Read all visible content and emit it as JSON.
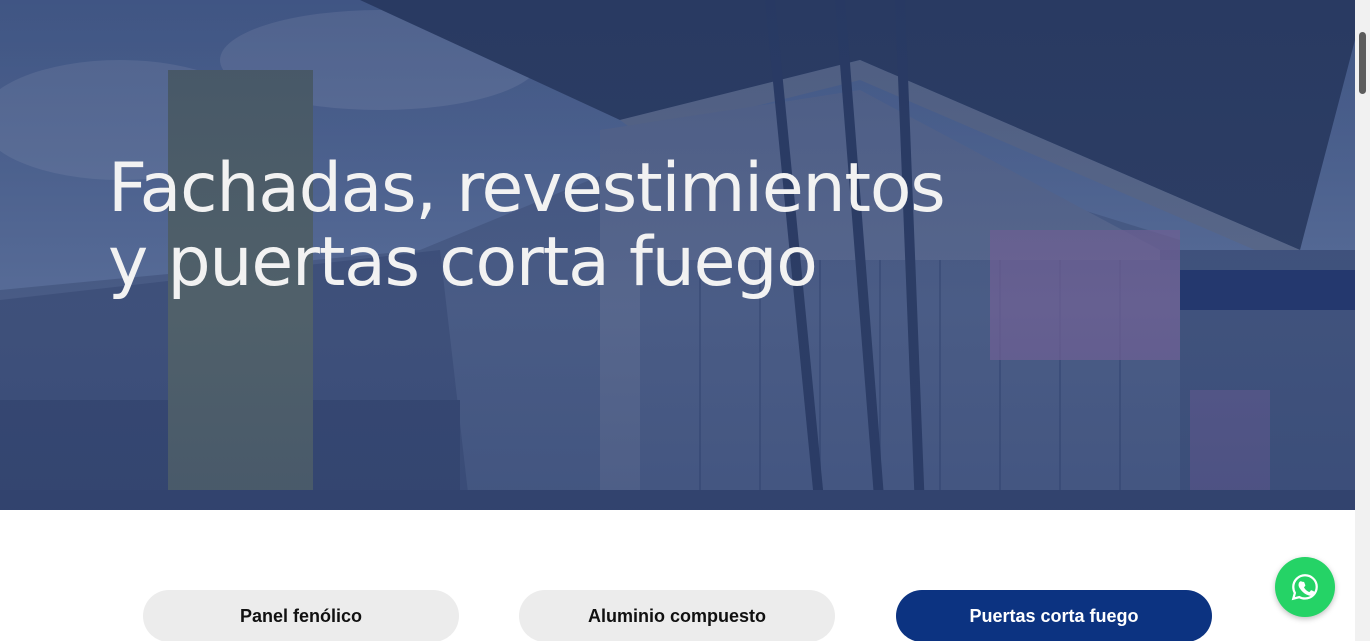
{
  "hero": {
    "title_line1": "Fachadas, revestimientos",
    "title_line2": "y puertas corta fuego",
    "overlay_color": "#1c3062"
  },
  "tabs": [
    {
      "label": "Panel fenólico",
      "active": false
    },
    {
      "label": "Aluminio compuesto",
      "active": false
    },
    {
      "label": "Puertas corta fuego",
      "active": true
    }
  ],
  "colors": {
    "active_tab": "#0c3381",
    "inactive_tab": "#ececec",
    "whatsapp": "#25d366"
  },
  "floating": {
    "icon": "whatsapp-icon"
  }
}
